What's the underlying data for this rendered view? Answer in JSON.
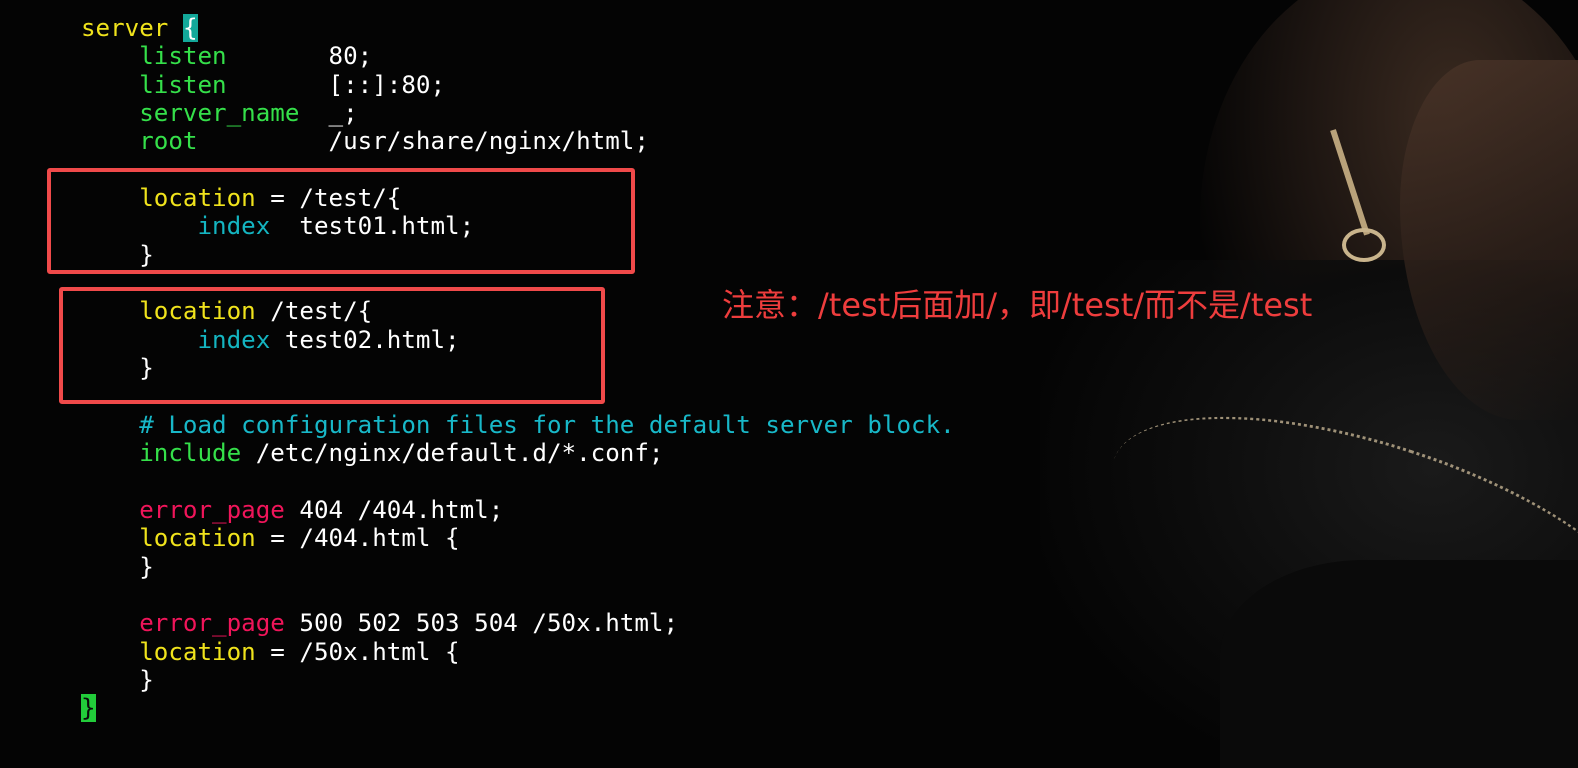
{
  "editor": {
    "lines": [
      [
        {
          "text": "server",
          "style": "kw-yellow"
        },
        {
          "text": " ",
          "style": "plain"
        },
        {
          "text": "{",
          "style": "hl-brace"
        }
      ],
      [
        {
          "text": "    ",
          "style": "plain"
        },
        {
          "text": "listen",
          "style": "kw-green"
        },
        {
          "text": "       80;",
          "style": "plain"
        }
      ],
      [
        {
          "text": "    ",
          "style": "plain"
        },
        {
          "text": "listen",
          "style": "kw-green"
        },
        {
          "text": "       [::]:80;",
          "style": "plain"
        }
      ],
      [
        {
          "text": "    ",
          "style": "plain"
        },
        {
          "text": "server_name",
          "style": "kw-green"
        },
        {
          "text": "  _;",
          "style": "plain"
        }
      ],
      [
        {
          "text": "    ",
          "style": "plain"
        },
        {
          "text": "root",
          "style": "kw-green"
        },
        {
          "text": "         /usr/share/nginx/html;",
          "style": "plain"
        }
      ],
      [],
      [
        {
          "text": "    ",
          "style": "plain"
        },
        {
          "text": "location",
          "style": "kw-yellow"
        },
        {
          "text": " = /test/{",
          "style": "plain"
        }
      ],
      [
        {
          "text": "        ",
          "style": "plain"
        },
        {
          "text": "index",
          "style": "kw-cyan"
        },
        {
          "text": "  test01.html;",
          "style": "plain"
        }
      ],
      [
        {
          "text": "    }",
          "style": "plain"
        }
      ],
      [],
      [
        {
          "text": "    ",
          "style": "plain"
        },
        {
          "text": "location",
          "style": "kw-yellow"
        },
        {
          "text": " /test/{",
          "style": "plain"
        }
      ],
      [
        {
          "text": "        ",
          "style": "plain"
        },
        {
          "text": "index",
          "style": "kw-cyan"
        },
        {
          "text": " test02.html;",
          "style": "plain"
        }
      ],
      [
        {
          "text": "    }",
          "style": "plain"
        }
      ],
      [],
      [
        {
          "text": "    ",
          "style": "plain"
        },
        {
          "text": "# Load configuration files for the default server block.",
          "style": "comment"
        }
      ],
      [
        {
          "text": "    ",
          "style": "plain"
        },
        {
          "text": "include",
          "style": "kw-green"
        },
        {
          "text": " /etc/nginx/default.d/*.conf;",
          "style": "plain"
        }
      ],
      [],
      [
        {
          "text": "    ",
          "style": "plain"
        },
        {
          "text": "error_page",
          "style": "kw-red"
        },
        {
          "text": " 404 /404.html;",
          "style": "plain"
        }
      ],
      [
        {
          "text": "    ",
          "style": "plain"
        },
        {
          "text": "location",
          "style": "kw-yellow"
        },
        {
          "text": " = /404.html {",
          "style": "plain"
        }
      ],
      [
        {
          "text": "    }",
          "style": "plain"
        }
      ],
      [],
      [
        {
          "text": "    ",
          "style": "plain"
        },
        {
          "text": "error_page",
          "style": "kw-red"
        },
        {
          "text": " 500 502 503 504 /50x.html;",
          "style": "plain"
        }
      ],
      [
        {
          "text": "    ",
          "style": "plain"
        },
        {
          "text": "location",
          "style": "kw-yellow"
        },
        {
          "text": " = /50x.html {",
          "style": "plain"
        }
      ],
      [
        {
          "text": "    }",
          "style": "plain"
        }
      ],
      [
        {
          "text": "}",
          "style": "hl-brace-green"
        }
      ]
    ]
  },
  "annotation": {
    "text": "注意：/test后面加/，即/test/而不是/test"
  },
  "colors": {
    "background": "#040404",
    "annotation": "#ee3d3d",
    "highlight_box": "#f04a4a"
  }
}
